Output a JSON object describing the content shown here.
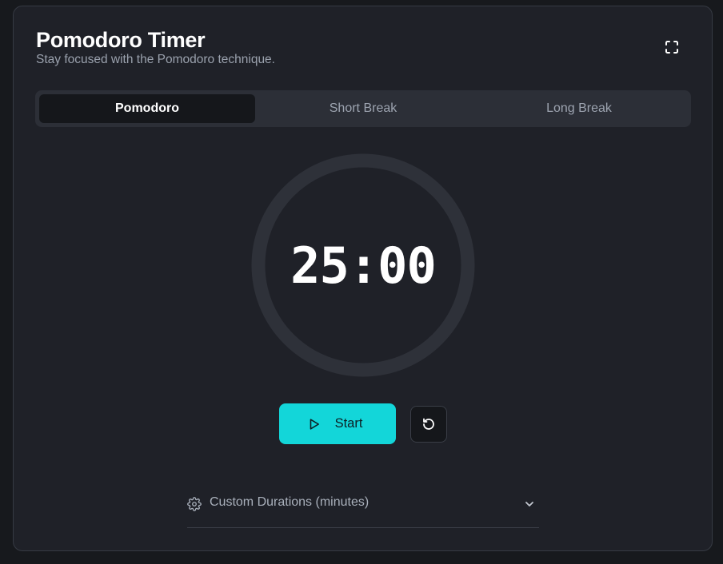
{
  "header": {
    "title": "Pomodoro Timer",
    "subtitle": "Stay focused with the Pomodoro technique."
  },
  "tabs": [
    {
      "label": "Pomodoro",
      "active": true
    },
    {
      "label": "Short Break",
      "active": false
    },
    {
      "label": "Long Break",
      "active": false
    }
  ],
  "timer": {
    "display": "25:00",
    "progress": 0
  },
  "controls": {
    "start_label": "Start"
  },
  "settings": {
    "custom_durations_label": "Custom Durations (minutes)"
  },
  "colors": {
    "accent": "#13d6d9",
    "background": "#1f2128",
    "ring": "#2e3139"
  },
  "icons": {
    "fullscreen": "fullscreen-icon",
    "play": "play-icon",
    "reset": "reset-icon",
    "gear": "gear-icon",
    "chevron": "chevron-down-icon"
  }
}
